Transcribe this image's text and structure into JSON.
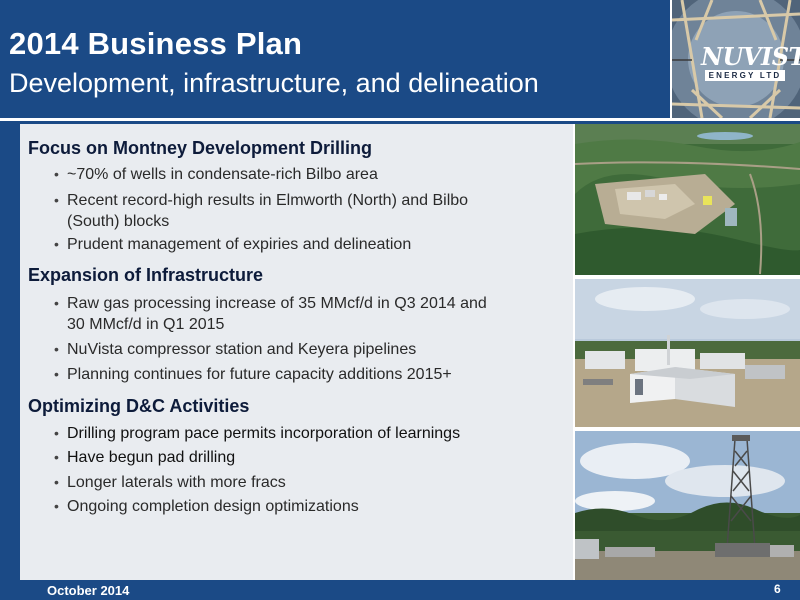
{
  "header": {
    "title": "2014 Business Plan",
    "subtitle": "Development, infrastructure, and delineation"
  },
  "logo": {
    "name": "NUVISTA",
    "tagline": "ENERGY LTD"
  },
  "sections": [
    {
      "heading": "Focus on Montney Development Drilling",
      "bullets": [
        [
          "~70% of wells in condensate-rich Bilbo area"
        ],
        [
          "Recent record-high results in Elmworth (North) and Bilbo",
          "(South) blocks"
        ],
        [
          "Prudent management of expiries and delineation"
        ]
      ]
    },
    {
      "heading": "Expansion of Infrastructure",
      "bullets": [
        [
          "Raw gas processing increase of 35 MMcf/d in Q3 2014 and",
          "30 MMcf/d in Q1 2015"
        ],
        [
          "NuVista compressor station and Keyera pipelines"
        ],
        [
          "Planning continues for future capacity additions 2015+"
        ]
      ]
    },
    {
      "heading": "Optimizing D&C Activities",
      "bullets": [
        [
          "Drilling program pace permits incorporation of learnings"
        ],
        [
          "Have begun pad drilling"
        ],
        [
          "Longer laterals with more fracs"
        ],
        [
          "Ongoing completion design optimizations"
        ]
      ]
    }
  ],
  "bullet_glyph": "•",
  "footer": {
    "date": "October 2014",
    "page": "6"
  },
  "colors": {
    "brand_blue": "#1b4a86",
    "content_bg": "#e9ecf0",
    "heading_text": "#0d1b3a"
  }
}
